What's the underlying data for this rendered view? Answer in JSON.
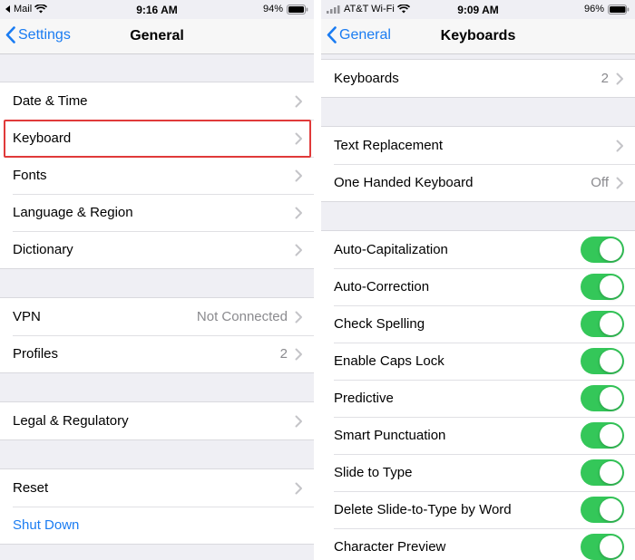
{
  "left": {
    "status": {
      "carrier": "Mail",
      "time": "9:16 AM",
      "battery": "94%"
    },
    "nav": {
      "back_label": "Settings",
      "title": "General"
    },
    "groups": [
      [
        {
          "label": "Date & Time",
          "chevron": true
        },
        {
          "label": "Keyboard",
          "chevron": true
        },
        {
          "label": "Fonts",
          "chevron": true
        },
        {
          "label": "Language & Region",
          "chevron": true
        },
        {
          "label": "Dictionary",
          "chevron": true
        }
      ],
      [
        {
          "label": "VPN",
          "value": "Not Connected",
          "chevron": true
        },
        {
          "label": "Profiles",
          "value": "2",
          "chevron": true
        }
      ],
      [
        {
          "label": "Legal & Regulatory",
          "chevron": true
        }
      ],
      [
        {
          "label": "Reset",
          "chevron": true
        },
        {
          "label": "Shut Down",
          "chevron": false,
          "style": "blue"
        }
      ]
    ]
  },
  "right": {
    "status": {
      "carrier": "AT&T Wi-Fi",
      "time": "9:09 AM",
      "battery": "96%"
    },
    "nav": {
      "back_label": "General",
      "title": "Keyboards"
    },
    "groups": [
      [
        {
          "label": "Keyboards",
          "value": "2",
          "chevron": true
        }
      ],
      [
        {
          "label": "Text Replacement",
          "chevron": true
        },
        {
          "label": "One Handed Keyboard",
          "value": "Off",
          "chevron": true
        }
      ],
      [
        {
          "label": "Auto-Capitalization",
          "toggle": true
        },
        {
          "label": "Auto-Correction",
          "toggle": true
        },
        {
          "label": "Check Spelling",
          "toggle": true
        },
        {
          "label": "Enable Caps Lock",
          "toggle": true
        },
        {
          "label": "Predictive",
          "toggle": true
        },
        {
          "label": "Smart Punctuation",
          "toggle": true
        },
        {
          "label": "Slide to Type",
          "toggle": true
        },
        {
          "label": "Delete Slide-to-Type by Word",
          "toggle": true
        },
        {
          "label": "Character Preview",
          "toggle": true
        }
      ]
    ]
  },
  "colors": {
    "accent": "#1a7cf2",
    "toggle_on": "#34c759",
    "highlight": "#e03a3a"
  }
}
